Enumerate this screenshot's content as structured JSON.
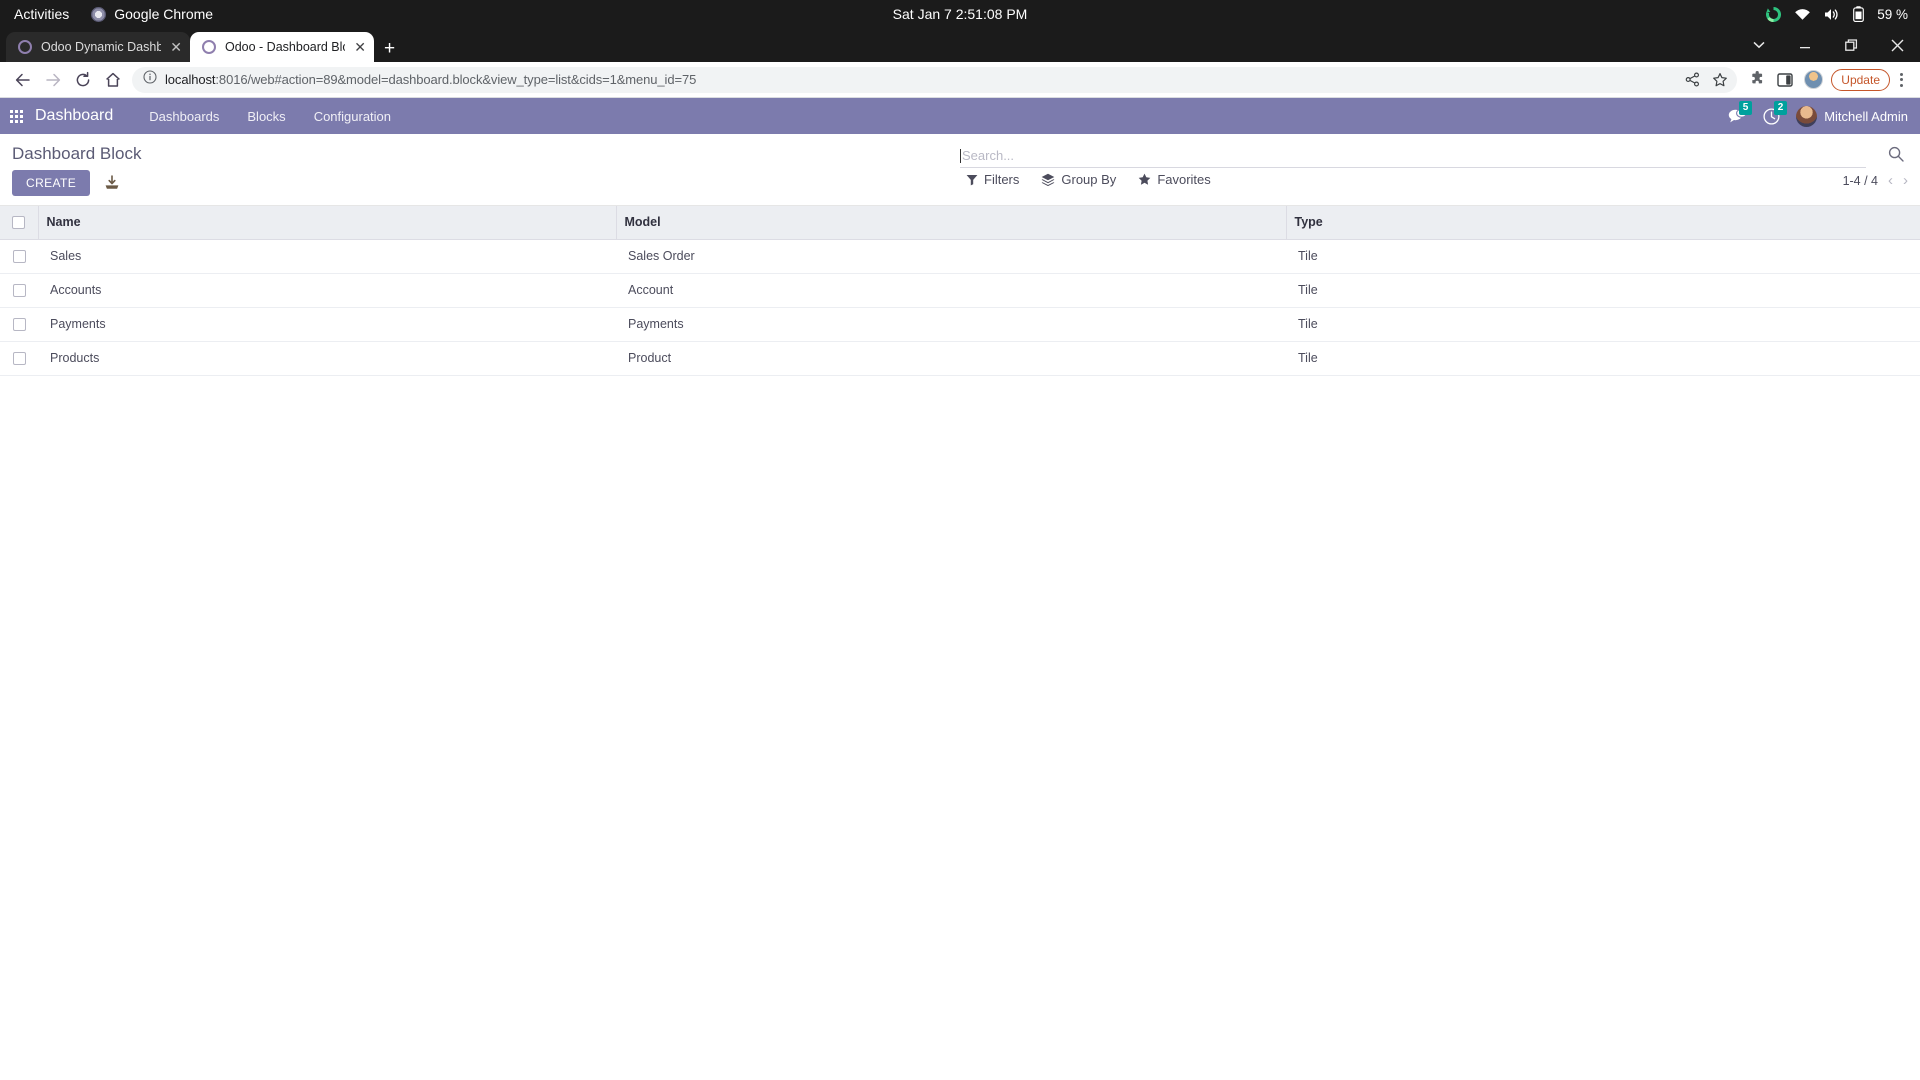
{
  "os_bar": {
    "activities": "Activities",
    "active_app": "Google Chrome",
    "clock": "Sat Jan 7  2:51:08 PM",
    "battery_percent": "59 %",
    "tray_icons": [
      "sync-icon",
      "wifi-icon",
      "volume-icon",
      "battery-icon"
    ]
  },
  "browser": {
    "tabs": [
      {
        "title": "Odoo Dynamic Dashboar",
        "active": false
      },
      {
        "title": "Odoo - Dashboard Block",
        "active": true
      }
    ],
    "new_tab_label": "+",
    "window_controls": [
      "tab-search-icon",
      "minimize-icon",
      "maximize-icon",
      "close-icon"
    ],
    "nav": {
      "back": "back-icon",
      "forward": "forward-icon",
      "reload": "reload-icon",
      "home": "home-icon"
    },
    "omnibox": {
      "site_info_icon": "info-circle-icon",
      "host": "localhost",
      "path": ":8016/web#action=89&model=dashboard.block&view_type=list&cids=1&menu_id=75",
      "full_url": "localhost:8016/web#action=89&model=dashboard.block&view_type=list&cids=1&menu_id=75",
      "share_icon": "share-icon",
      "bookmark_icon": "star-icon"
    },
    "toolbar_icons": [
      "extensions-puzzle-icon",
      "side-panel-icon",
      "profile-avatar"
    ],
    "update_button": "Update",
    "menu_icon": "kebab-menu-icon"
  },
  "odoo": {
    "navbar": {
      "apps_icon": "apps-grid-icon",
      "brand": "Dashboard",
      "menu_items": [
        "Dashboards",
        "Blocks",
        "Configuration"
      ],
      "messages_icon": "chat-bubble-icon",
      "messages_count": "5",
      "activities_icon": "clock-icon",
      "activities_count": "2",
      "user_name": "Mitchell Admin",
      "brand_color": "#7c7bad",
      "badge_color": "#00a09d"
    },
    "control_panel": {
      "title": "Dashboard Block",
      "create_button": "CREATE",
      "import_icon": "import-icon",
      "search_placeholder": "Search...",
      "search_value": "",
      "search_icon": "magnifier-icon",
      "filters": [
        {
          "label": "Filters",
          "icon": "funnel-icon"
        },
        {
          "label": "Group By",
          "icon": "layers-icon"
        },
        {
          "label": "Favorites",
          "icon": "star-icon"
        }
      ],
      "pager": "1-4 / 4",
      "pager_prev_icon": "chevron-left-icon",
      "pager_next_icon": "chevron-right-icon"
    },
    "list": {
      "columns": [
        "Name",
        "Model",
        "Type"
      ],
      "rows": [
        {
          "name": "Sales",
          "model": "Sales Order",
          "type": "Tile",
          "selected": false
        },
        {
          "name": "Accounts",
          "model": "Account",
          "type": "Tile",
          "selected": false
        },
        {
          "name": "Payments",
          "model": "Payments",
          "type": "Tile",
          "selected": false
        },
        {
          "name": "Products",
          "model": "Product",
          "type": "Tile",
          "selected": false
        }
      ]
    }
  }
}
